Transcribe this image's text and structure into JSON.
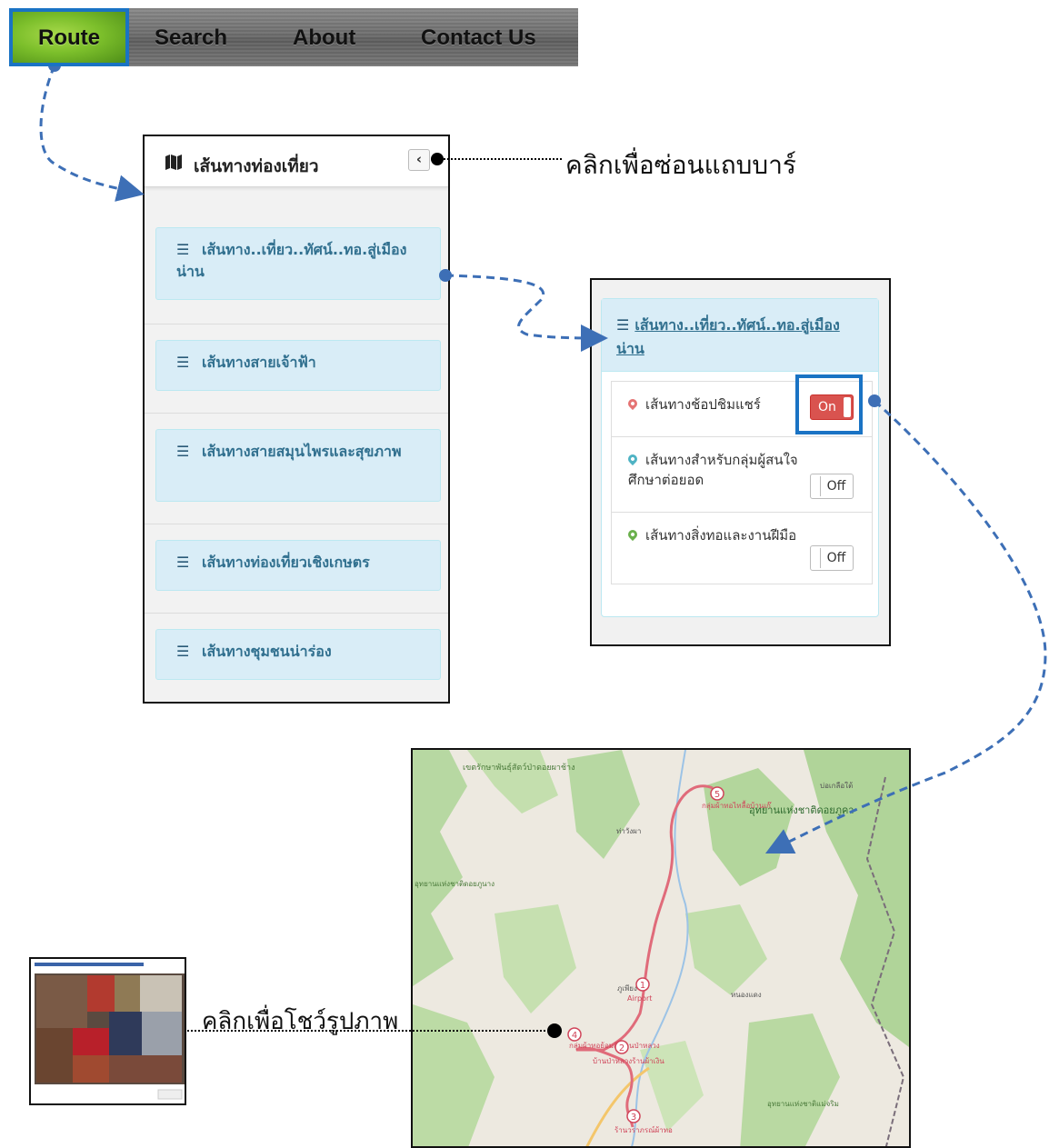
{
  "nav": {
    "items": [
      "Route",
      "Search",
      "About",
      "Contact Us"
    ],
    "active": "Route"
  },
  "sidebar": {
    "title": "เส้นทางท่องเที่ยว",
    "collapse_icon": "chevron-left-icon",
    "routes": [
      "เส้นทาง..เที่ยว..ทัศน์..ทอ.สู่เมืองน่าน",
      "เส้นทางสายเจ้าฟ้า",
      "เส้นทางสายสมุนไพรและสุขภาพ",
      "เส้นทางท่องเที่ยวเชิงเกษตร",
      "เส้นทางชุมชนน่าร่อง"
    ]
  },
  "detail": {
    "title": "เส้นทาง..เที่ยว..ทัศน์..ทอ.สู่เมืองน่าน",
    "toggles": [
      {
        "label": "เส้นทางช้อปชิมแชร์",
        "state": "On",
        "pin_color": "#e57373"
      },
      {
        "label": "เส้นทางสำหรับกลุ่มผู้สนใจศึกษาต่อยอด",
        "state": "Off",
        "pin_color": "#4fb3c4"
      },
      {
        "label": "เส้นทางสิ่งทอและงานฝีมือ",
        "state": "Off",
        "pin_color": "#6ab04c"
      }
    ]
  },
  "annotations": {
    "hide_sidebar": "คลิกเพื่อซ่อนแถบบาร์",
    "show_photo": "คลิกเพื่อโชว์รูปภาพ"
  },
  "map": {
    "markers": [
      {
        "num": "1",
        "label": "Airport"
      },
      {
        "num": "2",
        "label": "บ้านป่าหลวงร้านผ้าเงิน"
      },
      {
        "num": "3",
        "label": "ร้านวราภรณ์ผ้าทอ"
      },
      {
        "num": "4",
        "label": "กลุ่มผ้าทอย้อมสี บ้านป่าหลวง"
      },
      {
        "num": "5",
        "label": "กลุ่มผ้าทอไทลื้อบ้านเก๊"
      }
    ],
    "place_labels": [
      "เขตรักษาพันธุ์สัตว์ป่าดอยผาช้าง",
      "อุทยานแห่งชาติดอยภูคา",
      "อุทยานแห่งชาติดอยภูนาง",
      "อุทยานแห่งชาติแม่จริม",
      "ท่าวังผา",
      "หนองแดง",
      "ภูเพียง",
      "บ่อเกลือใต้"
    ]
  },
  "colors": {
    "accent": "#1a73c4",
    "card_bg": "#d9edf7",
    "card_text": "#31708f",
    "on": "#d9534f",
    "route_line": "#e06b7a"
  }
}
